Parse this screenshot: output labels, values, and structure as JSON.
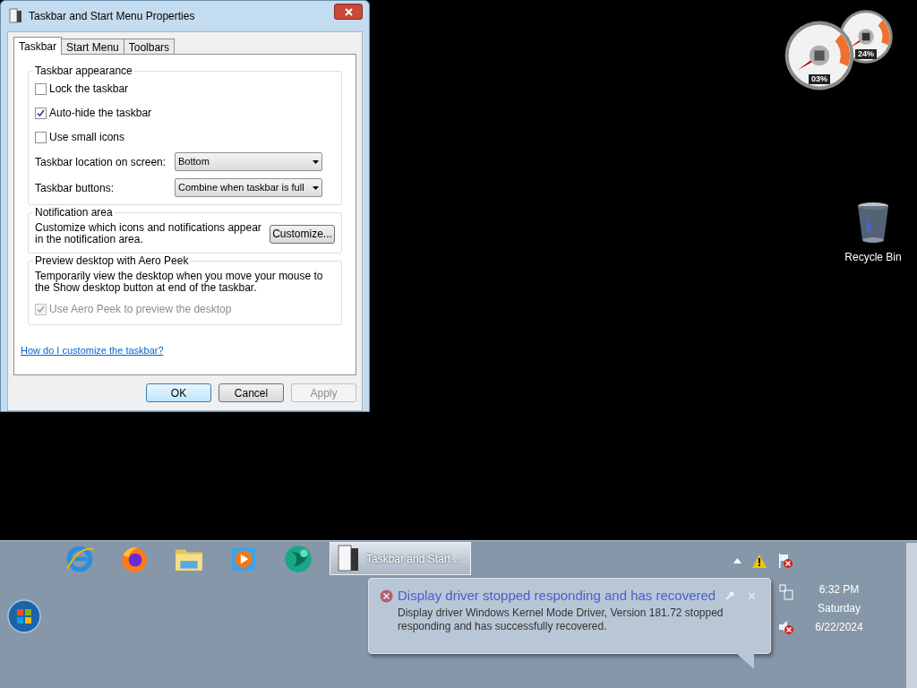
{
  "dialog": {
    "title": "Taskbar and Start Menu Properties",
    "tabs": [
      {
        "label": "Taskbar",
        "selected": true
      },
      {
        "label": "Start Menu",
        "selected": false
      },
      {
        "label": "Toolbars",
        "selected": false
      }
    ],
    "appearance": {
      "legend": "Taskbar appearance",
      "checkboxes": [
        {
          "label": "Lock the taskbar",
          "checked": false
        },
        {
          "label": "Auto-hide the taskbar",
          "checked": true
        },
        {
          "label": "Use small icons",
          "checked": false
        }
      ],
      "dropdowns": [
        {
          "label": "Taskbar location on screen:",
          "value": "Bottom"
        },
        {
          "label": "Taskbar buttons:",
          "value": "Combine when taskbar is full"
        }
      ]
    },
    "notification": {
      "legend": "Notification area",
      "text": "Customize which icons and notifications appear in the notification area.",
      "button": "Customize..."
    },
    "peek": {
      "legend": "Preview desktop with Aero Peek",
      "text": "Temporarily view the desktop when you move your mouse to the Show desktop button at end of the taskbar.",
      "checkbox": {
        "label": "Use Aero Peek to preview the desktop",
        "checked": true,
        "disabled": true
      }
    },
    "help_link": "How do I customize the taskbar?",
    "buttons": [
      {
        "label": "OK",
        "disabled": false,
        "default": true
      },
      {
        "label": "Cancel",
        "disabled": false,
        "default": false
      },
      {
        "label": "Apply",
        "disabled": true,
        "default": false
      }
    ]
  },
  "gadgets": [
    {
      "reading": "03%"
    },
    {
      "reading": "24%"
    }
  ],
  "desktop_icons": [
    {
      "label": "Recycle Bin"
    }
  ],
  "taskbar": {
    "pinned": [
      {
        "kind": "ie"
      },
      {
        "kind": "firefox"
      },
      {
        "kind": "folder"
      },
      {
        "kind": "media"
      },
      {
        "kind": "globe"
      }
    ],
    "window_button": {
      "label": "Taskbar and Start ..."
    },
    "clock": {
      "time": "6:32 PM",
      "day": "Saturday",
      "date": "6/22/2024"
    }
  },
  "balloon": {
    "title": "Display driver stopped responding and has recovered",
    "text": "Display driver Windows Kernel Mode Driver, Version 181.72 stopped responding and has successfully recovered."
  }
}
